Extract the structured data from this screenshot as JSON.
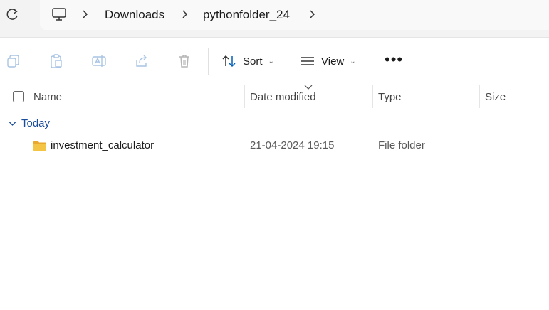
{
  "address_bar": {
    "breadcrumbs": [
      "Downloads",
      "pythonfolder_24"
    ],
    "icons": [
      "refresh-icon",
      "this-pc-icon",
      "chevron-right-icon"
    ]
  },
  "toolbar": {
    "sort_label": "Sort",
    "view_label": "View",
    "more_label": "•••",
    "icons": [
      "copy-icon",
      "paste-icon",
      "rename-icon",
      "share-icon",
      "delete-icon",
      "sort-icon",
      "view-icon"
    ]
  },
  "columns": {
    "name": "Name",
    "date_modified": "Date modified",
    "type": "Type",
    "size": "Size"
  },
  "groups": [
    {
      "label": "Today",
      "items": [
        {
          "name": "investment_calculator",
          "date_modified": "21-04-2024 19:15",
          "type": "File folder",
          "size": ""
        }
      ]
    }
  ],
  "colors": {
    "group_label": "#1b4d9a",
    "folder": "#f4c545",
    "accent": "#005fb8"
  }
}
